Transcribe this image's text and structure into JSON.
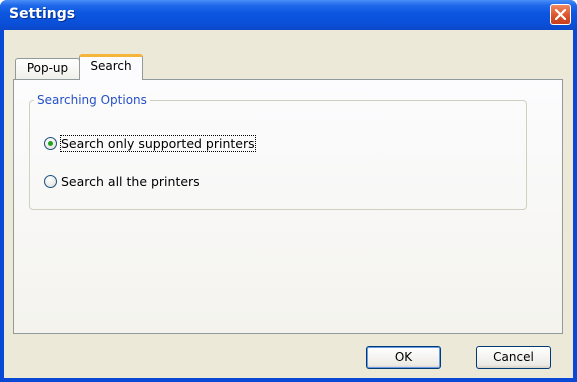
{
  "window": {
    "title": "Settings"
  },
  "tabs": [
    {
      "label": "Pop-up",
      "selected": false
    },
    {
      "label": "Search",
      "selected": true
    }
  ],
  "search_options": {
    "group_label": "Searching Options",
    "options": [
      {
        "label": "Search only supported printers",
        "checked": true
      },
      {
        "label": "Search all the printers",
        "checked": false
      }
    ]
  },
  "buttons": {
    "ok": "OK",
    "cancel": "Cancel"
  },
  "colors": {
    "titlebar": "#0a4fd8",
    "client_bg": "#ece9d8",
    "group_label": "#2550c8",
    "selected_tab_accent": "#f5b43a",
    "close_button": "#d9502a"
  }
}
